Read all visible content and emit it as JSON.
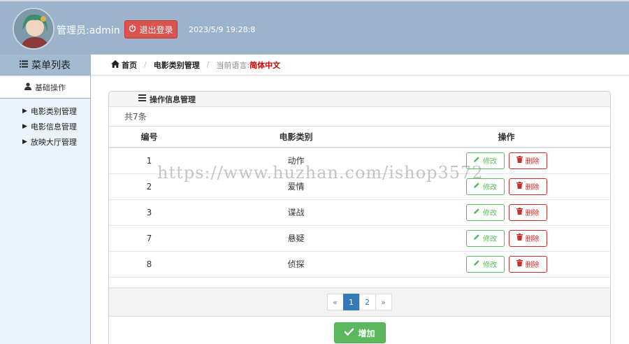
{
  "header": {
    "admin_label": "管理员:admin",
    "logout_label": "退出登录",
    "datetime": "2023/5/9 19:28:8"
  },
  "sidebar": {
    "title": "菜单列表",
    "section": "基础操作",
    "items": [
      {
        "label": "电影类别管理"
      },
      {
        "label": "电影信息管理"
      },
      {
        "label": "放映大厅管理"
      }
    ]
  },
  "breadcrumb": {
    "home": "首页",
    "current": "电影类别管理",
    "lang_label": "当前语言:",
    "lang_value": "简体中文"
  },
  "panel": {
    "title": "操作信息管理",
    "count": "共7条",
    "columns": [
      "编号",
      "电影类别",
      "操作"
    ],
    "rows": [
      {
        "id": "1",
        "type": "动作"
      },
      {
        "id": "2",
        "type": "爱情"
      },
      {
        "id": "3",
        "type": "谍战"
      },
      {
        "id": "7",
        "type": "悬疑"
      },
      {
        "id": "8",
        "type": "侦探"
      }
    ],
    "edit_label": "修改",
    "delete_label": "删除",
    "pager": {
      "prev": "«",
      "pages": [
        "1",
        "2"
      ],
      "next": "»",
      "active": "1"
    },
    "add_label": "增加"
  },
  "watermark": "https://www.huzhan.com/ishop3572",
  "colors": {
    "header_bg": "#9cb4cb",
    "danger": "#d9534f",
    "success": "#5cb85c",
    "primary": "#337ab7"
  }
}
